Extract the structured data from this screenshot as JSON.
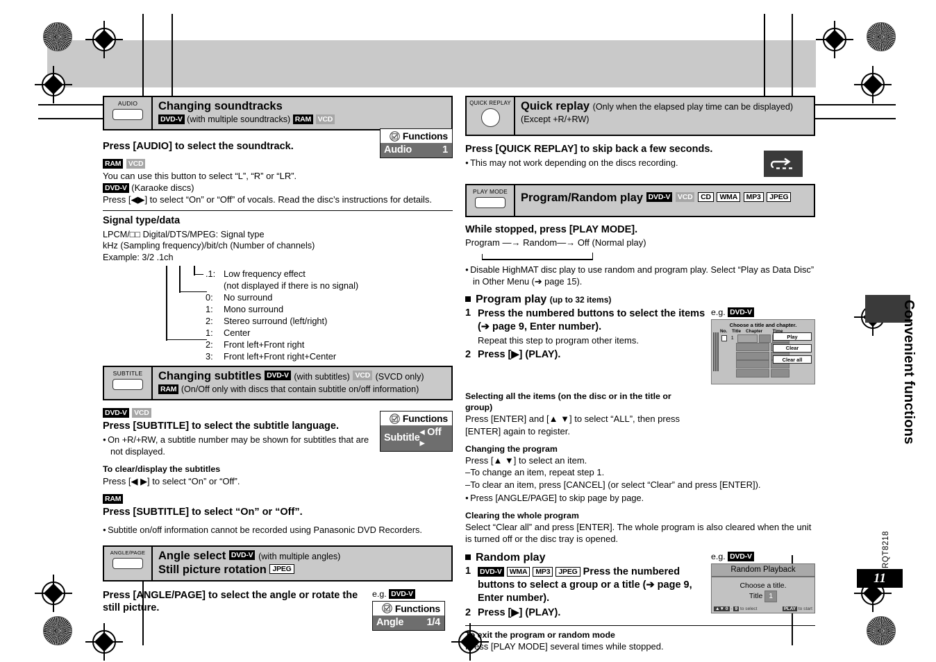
{
  "page": {
    "side_title": "Convenient functions",
    "doc_code": "RQT8218",
    "page_number": "11"
  },
  "left_column": {
    "soundtracks": {
      "button_label": "AUDIO",
      "title": "Changing soundtracks",
      "badges_1": [
        "DVD-V"
      ],
      "sub_text": "(with multiple soundtracks)",
      "badges_2": [
        "RAM",
        "VCD"
      ],
      "instruction": "Press [AUDIO] to select the soundtrack.",
      "badge_row_a": [
        "RAM",
        "VCD"
      ],
      "line_a": "You can use this button to select “L”, “R” or “LR”.",
      "badge_row_b": [
        "DVD-V"
      ],
      "line_b": "(Karaoke discs)",
      "line_c": "Press [◀▶] to select “On” or “Off” of vocals. Read the disc’s instructions for details.",
      "functions": {
        "header": "Functions",
        "name": "Audio",
        "value": "1"
      }
    },
    "signal": {
      "heading": "Signal type/data",
      "line1": "LPCM/□□ Digital/DTS/MPEG:  Signal type",
      "line2": "kHz (Sampling frequency)/bit/ch (Number of channels)",
      "line3": "Example:  3/2 .1ch",
      "items": [
        {
          "key": ".1:",
          "text": "Low frequency effect"
        },
        {
          "key": "",
          "text": "(not displayed if there is no signal)"
        },
        {
          "key": "0:",
          "text": "No surround"
        },
        {
          "key": "1:",
          "text": "Mono surround"
        },
        {
          "key": "2:",
          "text": "Stereo surround (left/right)"
        },
        {
          "key": "1:",
          "text": "Center"
        },
        {
          "key": "2:",
          "text": "Front left+Front right"
        },
        {
          "key": "3:",
          "text": "Front left+Front right+Center"
        }
      ]
    },
    "subtitles": {
      "button_label": "SUBTITLE",
      "title": "Changing subtitles",
      "badge_dvd": "DVD-V",
      "with_subtitles": "(with subtitles)",
      "badge_vcd": "VCD",
      "svcd_only": "(SVCD only)",
      "badge_ram": "RAM",
      "ram_note": "(On/Off only with discs that contain subtitle on/off information)",
      "badges_row": [
        "DVD-V",
        "VCD"
      ],
      "instruction": "Press [SUBTITLE] to select the subtitle language.",
      "bullet": "On +R/+RW, a subtitle number may be shown for subtitles that are not displayed.",
      "clear_heading": "To clear/display the subtitles",
      "clear_text": "Press [◀ ▶] to select “On” or “Off”.",
      "ram_badge2": "RAM",
      "ram_instruction": "Press [SUBTITLE] to select “On” or “Off”.",
      "bullet2": "Subtitle on/off information cannot be recorded using Panasonic DVD Recorders.",
      "functions": {
        "header": "Functions",
        "name": "Subtitle",
        "value": "Off"
      }
    },
    "angle": {
      "button_label": "ANGLE/PAGE",
      "title1": "Angle select",
      "badge1": "DVD-V",
      "sub1": "(with multiple angles)",
      "title2": "Still picture rotation",
      "badge2": "JPEG",
      "instruction": "Press [ANGLE/PAGE] to select the angle or rotate the still picture.",
      "eg_label": "e.g.",
      "eg_badge": "DVD-V",
      "functions": {
        "header": "Functions",
        "name": "Angle",
        "value": "1/4"
      }
    }
  },
  "right_column": {
    "quick_replay": {
      "button_label": "QUICK REPLAY",
      "title": "Quick replay",
      "sub": "(Only when the elapsed play time can be displayed)",
      "sub2": "(Except +R/+RW)",
      "instruction": "Press [QUICK REPLAY] to skip back a few seconds.",
      "bullet": "This may not work depending on the discs recording.",
      "icon_name": "quick-replay-icon"
    },
    "program_random": {
      "button_label": "PLAY MODE",
      "title": "Program/Random play",
      "badges": [
        "DVD-V",
        "VCD",
        "CD",
        "WMA",
        "MP3",
        "JPEG"
      ],
      "instruction": "While stopped, press [PLAY MODE].",
      "flow": "Program —→ Random—→ Off (Normal play)",
      "bullet": "Disable HighMAT disc play to use random and program play. Select “Play as Data Disc” in Other Menu (➔ page 15).",
      "program_play": {
        "heading": "Program play",
        "heading_sub": "(up to 32 items)",
        "step1_num": "1",
        "step1_text": "Press the numbered buttons to select the items (➔ page 9, Enter number).",
        "step1_note": "Repeat this step to program other items.",
        "step2_num": "2",
        "step2_text": "Press [▶] (PLAY).",
        "select_all_heading": "Selecting all the items (on the disc or in the title or group)",
        "select_all_text": "Press [ENTER] and [▲ ▼] to select “ALL”, then press [ENTER] again to register.",
        "change_heading": "Changing the program",
        "change_line1": "Press [▲ ▼] to select an item.",
        "change_line2": "–To change an item, repeat step 1.",
        "change_line3": "–To clear an item, press [CANCEL] (or select “Clear” and press [ENTER]).",
        "change_bullet": "Press [ANGLE/PAGE] to skip page by page.",
        "clear_heading": "Clearing the whole program",
        "clear_text": "Select “Clear all” and press [ENTER]. The whole program is also cleared when the unit is turned off or the disc tray is opened.",
        "eg_label": "e.g.",
        "eg_badge": "DVD-V",
        "mock": {
          "title": "Choose a title and chapter.",
          "columns": [
            "No.",
            "Title",
            "Chapter",
            "Time"
          ],
          "first_row_no": "1",
          "buttons": [
            "Play",
            "Clear",
            "Clear all"
          ]
        }
      },
      "random_play": {
        "heading": "Random play",
        "step1_num": "1",
        "step1_badges": [
          "DVD-V",
          "WMA",
          "MP3",
          "JPEG"
        ],
        "step1_text": "Press the numbered buttons to select a group or a title (➔ page 9, Enter number).",
        "step2_num": "2",
        "step2_text": "Press [▶] (PLAY).",
        "eg_label": "e.g.",
        "eg_badge": "DVD-V",
        "mock": {
          "title": "Random Playback",
          "prompt": "Choose a title.",
          "field_label": "Title",
          "field_value": "1",
          "foot_left_keys": "▲▼ 0",
          "foot_left_keys2": "9",
          "foot_left_text": "to select",
          "foot_right_key": "PLAY",
          "foot_right_text": "to start"
        }
      },
      "exit": {
        "heading": "To exit the program or random mode",
        "text": "Press [PLAY MODE] several times while stopped."
      }
    }
  }
}
